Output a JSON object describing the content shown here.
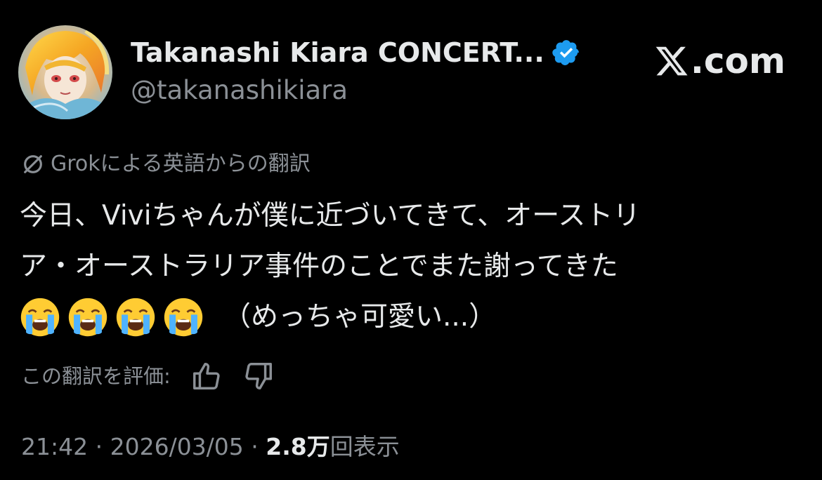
{
  "author": {
    "display_name": "Takanashi Kiara CONCERT...",
    "handle": "@takanashikiara",
    "verified": true,
    "verified_color": "#1d9bf0",
    "avatar_icon": "avatar-image"
  },
  "brand": {
    "text": ".com",
    "icon": "x-logo-icon"
  },
  "translation": {
    "note": "Grokによる英語からの翻訳",
    "icon": "grok-icon"
  },
  "tweet": {
    "line1": "今日、Viviちゃんが僕に近づいてきて、オーストリ",
    "line2": "ア・オーストラリア事件のことでまた謝ってきた",
    "emoji": [
      "crying-face",
      "crying-face",
      "crying-face",
      "crying-face"
    ],
    "line3_after": "（めっちゃ可愛い...）"
  },
  "rating": {
    "label": "この翻訳を評価:",
    "like_icon": "thumbs-up-icon",
    "dislike_icon": "thumbs-down-icon"
  },
  "meta": {
    "time": "21:42",
    "sep1": " · ",
    "date": "2026/03/05",
    "sep2": " · ",
    "views_count": "2.8万",
    "views_label": "回表示"
  },
  "colors": {
    "background": "#000000",
    "text_primary": "#e7e9ea",
    "text_secondary": "#8b9096",
    "accent": "#1d9bf0"
  }
}
